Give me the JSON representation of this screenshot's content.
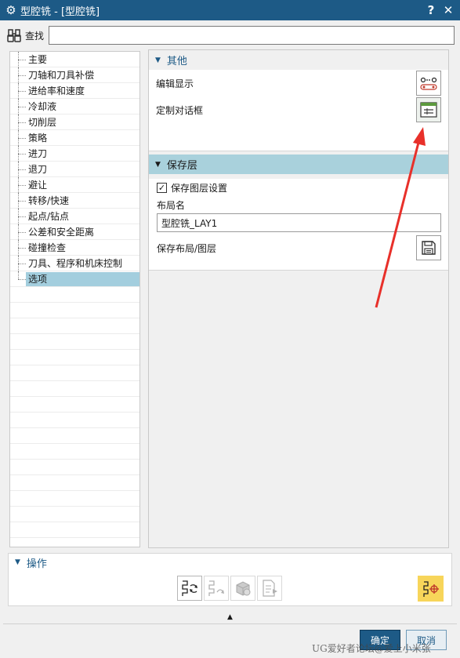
{
  "window": {
    "title": "型腔铣 - [型腔铣]",
    "help_label": "?",
    "close_label": "✕"
  },
  "search": {
    "label": "查找",
    "value": ""
  },
  "tree": {
    "items": [
      {
        "label": "主要"
      },
      {
        "label": "刀轴和刀具补偿"
      },
      {
        "label": "进给率和速度"
      },
      {
        "label": "冷却液"
      },
      {
        "label": "切削层"
      },
      {
        "label": "策略"
      },
      {
        "label": "进刀"
      },
      {
        "label": "退刀"
      },
      {
        "label": "避让"
      },
      {
        "label": "转移/快速"
      },
      {
        "label": "起点/钻点"
      },
      {
        "label": "公差和安全距离"
      },
      {
        "label": "碰撞检查"
      },
      {
        "label": "刀具、程序和机床控制"
      },
      {
        "label": "选项",
        "selected": true
      }
    ]
  },
  "panel": {
    "other": {
      "title": "其他",
      "edit_display_label": "编辑显示",
      "custom_dialog_label": "定制对话框"
    },
    "save_layer": {
      "title": "保存层",
      "save_layer_settings_label": "保存图层设置",
      "save_layer_settings_checked": true,
      "layout_name_label": "布局名",
      "layout_name_value": "型腔铣_LAY1",
      "save_layout_label": "保存布局/图层"
    }
  },
  "operations": {
    "title": "操作"
  },
  "buttons": {
    "ok": "确定",
    "cancel": "取消"
  },
  "watermark": "UG爱好者论坛@爱上小米张",
  "colors": {
    "accent": "#1d5a86",
    "section_highlight": "#a9d1dc",
    "selected_item": "#a3cede",
    "annotation_arrow": "#e8302a",
    "generate_button": "#f7d55a"
  }
}
